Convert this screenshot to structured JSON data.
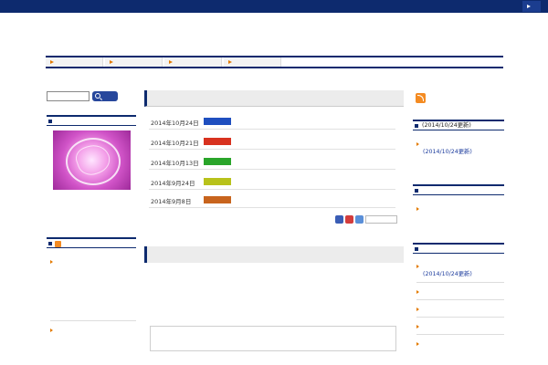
{
  "topbar": {
    "link_label": ""
  },
  "header": {
    "site_title": "",
    "description": ""
  },
  "nav": {
    "items": [
      "",
      "",
      "",
      ""
    ]
  },
  "breadcrumb": "",
  "search": {
    "value": "",
    "button_label": ""
  },
  "left_sidebar": {
    "profile_heading": "",
    "profile_text": "",
    "blog_heading": "",
    "blog_items": [
      {
        "title": "",
        "date": "",
        "excerpt": "",
        "ellipsis": ""
      },
      {
        "title": "",
        "date": ""
      }
    ]
  },
  "news": {
    "heading": "",
    "items": [
      {
        "date": "2014年10月24日",
        "tag": "",
        "tag_color": "#1f4fbf",
        "title": ""
      },
      {
        "date": "2014年10月21日",
        "tag": "",
        "tag_color": "#d8321f",
        "title": ""
      },
      {
        "date": "2014年10月13日",
        "tag": "",
        "tag_color": "#2aa52a",
        "title": ""
      },
      {
        "date": "2014年9月24日",
        "tag": "",
        "tag_color": "#b8c21b",
        "title": ""
      },
      {
        "date": "2014年9月8日",
        "tag": "",
        "tag_color": "#c8641d",
        "title": ""
      }
    ],
    "share_icons": [
      "",
      "",
      "",
      ""
    ]
  },
  "article": {
    "heading": "",
    "text": "",
    "more_link": "",
    "box_text": "",
    "bottom_link": ""
  },
  "right_sidebar": {
    "rss_label": "",
    "widget1": {
      "heading": "",
      "updated": "(2014/10/24更新)",
      "link": "",
      "date": "(2014/10/24更新)"
    },
    "widget2": {
      "heading": "",
      "link": ""
    },
    "widget3": {
      "heading": "",
      "items": [
        {
          "title": "",
          "date": "(2014/10/24更新)"
        },
        {
          "title": ""
        },
        {
          "title": ""
        },
        {
          "title": ""
        },
        {
          "title": ""
        }
      ]
    }
  }
}
